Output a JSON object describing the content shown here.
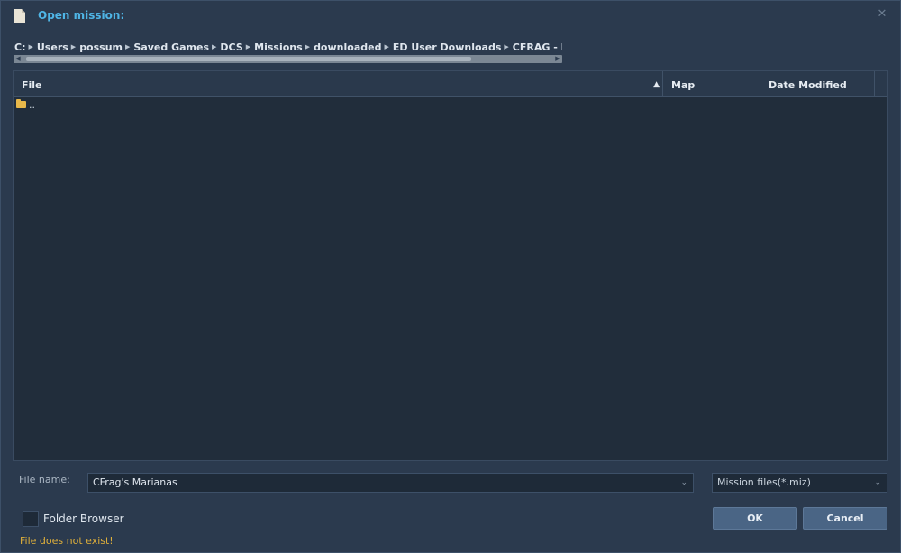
{
  "window": {
    "title": "Open mission:",
    "icon": "document-icon",
    "close_icon": "close-icon"
  },
  "breadcrumb": [
    "C:",
    "Users",
    "possum",
    "Saved Games",
    "DCS",
    "Missions",
    "downloaded",
    "ED User Downloads",
    "CFRAG - Proving Grou"
  ],
  "file_list": {
    "columns": [
      "File",
      "Map",
      "Date Modified"
    ],
    "sorted_column": "File",
    "sort_direction": "ascending",
    "rows": [
      {
        "icon": "folder-icon",
        "name": ".."
      }
    ]
  },
  "footer": {
    "file_name_label": "File name:",
    "file_name_value": "CFrag's Marianas",
    "filter_value": "Mission files(*.miz)",
    "folder_browser_label": "Folder Browser",
    "folder_browser_checked": false,
    "ok_label": "OK",
    "cancel_label": "Cancel",
    "error_text": "File does not exist!"
  },
  "colors": {
    "title": "#4fb5e6",
    "error": "#e0b03a",
    "button": "#4a6585",
    "folder": "#e8b84a"
  }
}
